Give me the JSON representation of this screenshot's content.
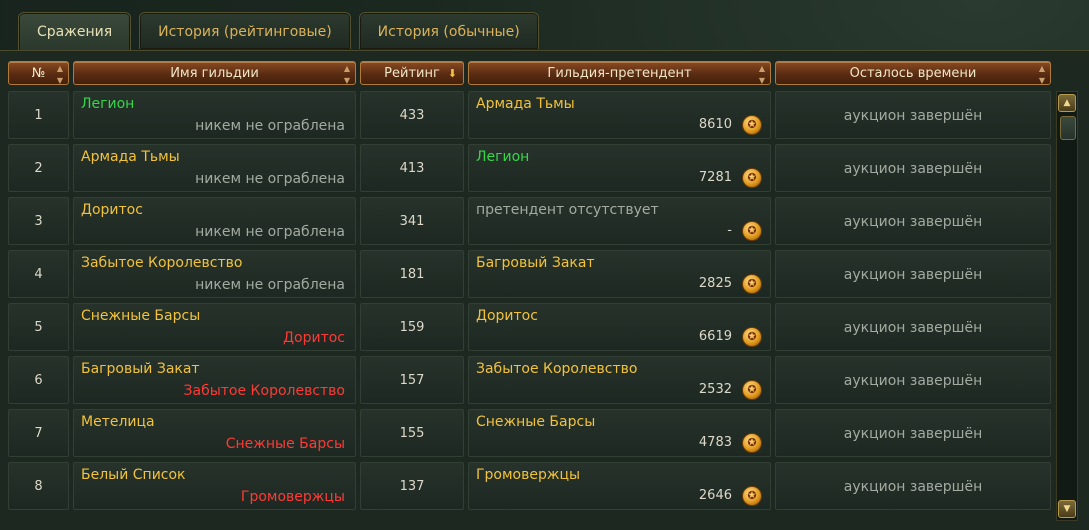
{
  "tabs": [
    {
      "label": "Сражения",
      "active": true
    },
    {
      "label": "История (рейтинговые)",
      "active": false
    },
    {
      "label": "История (обычные)",
      "active": false
    }
  ],
  "columns": {
    "num": "№",
    "guild": "Имя гильдии",
    "rating": "Рейтинг",
    "contender": "Гильдия-претендент",
    "time": "Осталось времени"
  },
  "colors": {
    "green": "#36d64a",
    "yellow": "#f2c23a",
    "grey": "#a3aba0",
    "red": "#ff3a36"
  },
  "rows": [
    {
      "num": "1",
      "guild": "Легион",
      "guild_color": "green",
      "status": "никем не ограблена",
      "status_color": "grey",
      "rating": "433",
      "contender": "Армада Тьмы",
      "contender_color": "yellow",
      "bid": "8610",
      "time": "аукцион завершён"
    },
    {
      "num": "2",
      "guild": "Армада Тьмы",
      "guild_color": "yellow",
      "status": "никем не ограблена",
      "status_color": "grey",
      "rating": "413",
      "contender": "Легион",
      "contender_color": "green",
      "bid": "7281",
      "time": "аукцион завершён"
    },
    {
      "num": "3",
      "guild": "Доритос",
      "guild_color": "yellow",
      "status": "никем не ограблена",
      "status_color": "grey",
      "rating": "341",
      "contender": "претендент отсутствует",
      "contender_color": "grey",
      "bid": "-",
      "time": "аукцион завершён"
    },
    {
      "num": "4",
      "guild": "Забытое Королевство",
      "guild_color": "yellow",
      "status": "никем не ограблена",
      "status_color": "grey",
      "rating": "181",
      "contender": "Багровый Закат",
      "contender_color": "yellow",
      "bid": "2825",
      "time": "аукцион завершён"
    },
    {
      "num": "5",
      "guild": "Снежные Барсы",
      "guild_color": "yellow",
      "status": "Доритос",
      "status_color": "red",
      "rating": "159",
      "contender": "Доритос",
      "contender_color": "yellow",
      "bid": "6619",
      "time": "аукцион завершён"
    },
    {
      "num": "6",
      "guild": "Багровый Закат",
      "guild_color": "yellow",
      "status": "Забытое Королевство",
      "status_color": "red",
      "rating": "157",
      "contender": "Забытое Королевство",
      "contender_color": "yellow",
      "bid": "2532",
      "time": "аукцион завершён"
    },
    {
      "num": "7",
      "guild": "Метелица",
      "guild_color": "yellow",
      "status": "Снежные Барсы",
      "status_color": "red",
      "rating": "155",
      "contender": "Снежные Барсы",
      "contender_color": "yellow",
      "bid": "4783",
      "time": "аукцион завершён"
    },
    {
      "num": "8",
      "guild": "Белый Список",
      "guild_color": "yellow",
      "status": "Громовержцы",
      "status_color": "red",
      "rating": "137",
      "contender": "Громовержцы",
      "contender_color": "yellow",
      "bid": "2646",
      "time": "аукцион завершён"
    }
  ],
  "icons": {
    "coin": "gold-coin-icon",
    "sort": "sort-desc-icon",
    "scroll_up": "scroll-up-icon",
    "scroll_down": "scroll-down-icon"
  }
}
